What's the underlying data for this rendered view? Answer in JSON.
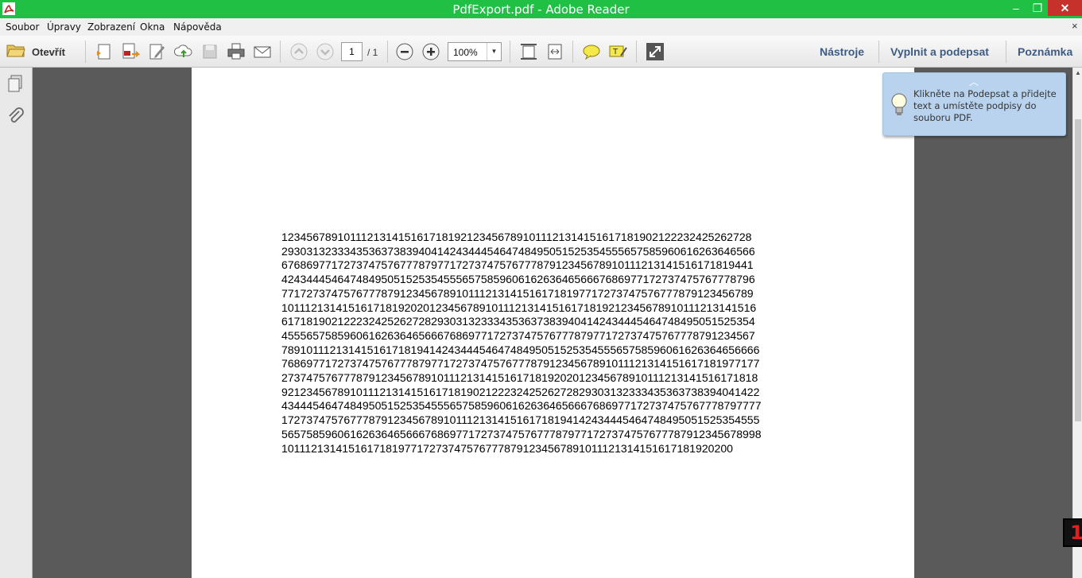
{
  "window": {
    "title": "PdfExport.pdf - Adobe Reader",
    "minimize": "–",
    "maximize": "❐",
    "close": "✕"
  },
  "menu": {
    "items": [
      "Soubor",
      "Úpravy",
      "Zobrazení",
      "Okna",
      "Nápověda"
    ],
    "close_doc": "×"
  },
  "toolbar": {
    "open_label": "Otevřít",
    "page_current": "1",
    "page_total": "/ 1",
    "zoom": "100%",
    "right_links": [
      "Nástroje",
      "Vyplnit a podepsat",
      "Poznámka"
    ]
  },
  "tooltip": {
    "text": "Klikněte na Podepsat a přidejte text a umístěte podpisy do souboru PDF."
  },
  "document": {
    "lines": [
      "1234567891011121314151617181921234567891011121314151617181902122232425262728",
      "2930313233343536373839404142434445464748495051525354555657585960616263646566",
      "6768697717273747576777879771727374757677787912345678910111213141516171819441",
      "4243444546474849505152535455565758596061626364656667686977172737475767778796",
      "7717273747576777879123456789101112131415161718197717273747576777879123456789",
      "10111213141516171819202012345678910111213141516171819212345678910111213141516",
      "6171819021222324252627282930313233343536373839404142434445464748495051525354",
      "4555657585960616263646566676869771727374757677787977172737475767778791234567",
      "78910111213141516171819414243444546474849505152535455565758596061626364656666",
      "76869771727374757677787977172737475767778791234567891011121314151617181977177",
      "27374757677787912345678910111213141516171819202012345678910111213141516171818",
      "92123456789101112131415161718190212223242526272829303132333435363738394041422",
      "43444546474849505152535455565758596061626364656667686977172737475767778797777",
      "17273747576777879123456789101112131415161718194142434445464748495051525354555",
      "56575859606162636465666768697717273747576777879771727374757677787912345678998",
      "1011121314151617181977172737475767778791234567891011121314151617181920200"
    ]
  },
  "badge": {
    "value": "1"
  }
}
